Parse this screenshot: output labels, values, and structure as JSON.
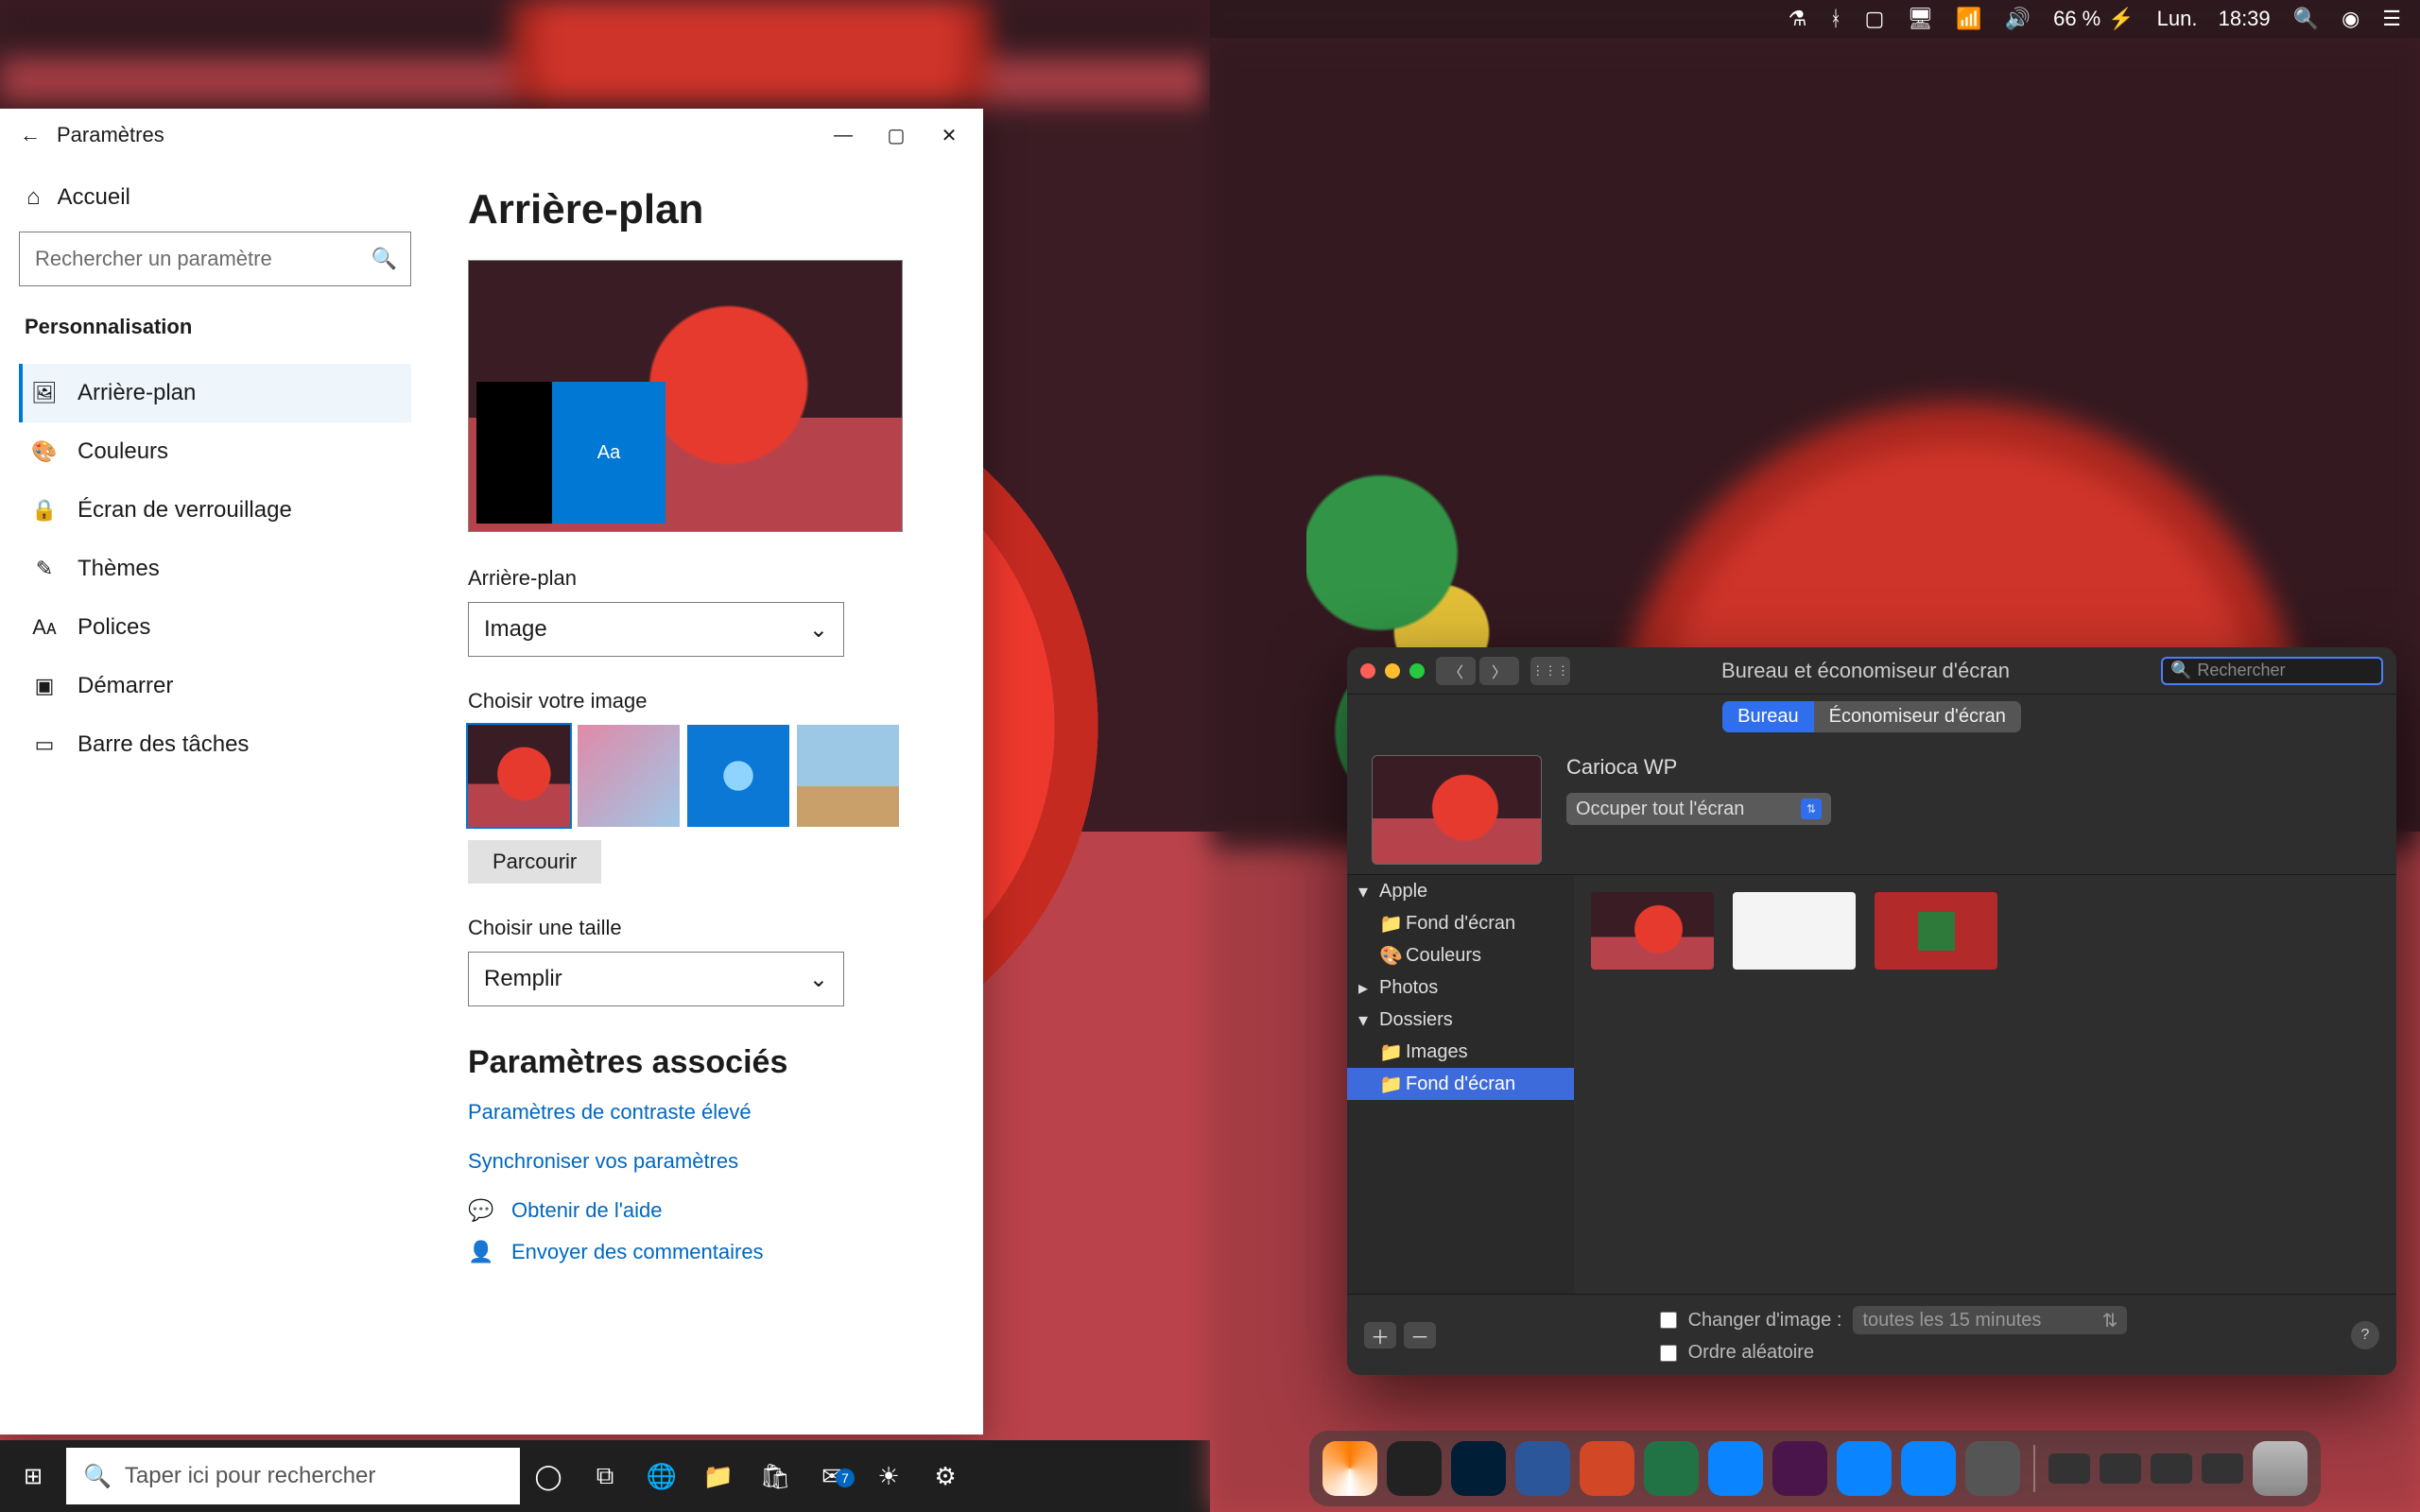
{
  "windows": {
    "titlebar": {
      "title": "Paramètres",
      "back_icon": "←",
      "min": "—",
      "max": "▢",
      "close": "✕"
    },
    "nav": {
      "home_label": "Accueil",
      "search_placeholder": "Rechercher un paramètre",
      "section": "Personnalisation",
      "items": [
        {
          "icon": "🖼",
          "label": "Arrière-plan",
          "active": true
        },
        {
          "icon": "🎨",
          "label": "Couleurs"
        },
        {
          "icon": "🔒",
          "label": "Écran de verrouillage"
        },
        {
          "icon": "✎",
          "label": "Thèmes"
        },
        {
          "icon": "Aᴀ",
          "label": "Polices"
        },
        {
          "icon": "▣",
          "label": "Démarrer"
        },
        {
          "icon": "▭",
          "label": "Barre des tâches"
        }
      ]
    },
    "content": {
      "heading": "Arrière-plan",
      "preview_tile_text": "Aa",
      "bg_label": "Arrière-plan",
      "bg_value": "Image",
      "choose_img_label": "Choisir votre image",
      "browse": "Parcourir",
      "fit_label": "Choisir une taille",
      "fit_value": "Remplir",
      "related_heading": "Paramètres associés",
      "link_contrast": "Paramètres de contraste élevé",
      "link_sync": "Synchroniser vos paramètres",
      "help": "Obtenir de l'aide",
      "feedback": "Envoyer des commentaires"
    },
    "taskbar": {
      "search_placeholder": "Taper ici pour rechercher",
      "icons": [
        "start",
        "search",
        "cortana",
        "taskview",
        "edge",
        "explorer",
        "store",
        "mail",
        "weather",
        "settings"
      ],
      "mail_badge": "7"
    }
  },
  "mac": {
    "menubar": {
      "battery": "66 %",
      "charging": "⚡",
      "day": "Lun.",
      "time": "18:39"
    },
    "window": {
      "title": "Bureau et économiseur d'écran",
      "search_placeholder": "Rechercher",
      "tab_on": "Bureau",
      "tab_off": "Économiseur d'écran",
      "wp_name": "Carioca WP",
      "fit_value": "Occuper tout l'écran",
      "side": {
        "apple": "Apple",
        "apple_wall": "Fond d'écran",
        "apple_colors": "Couleurs",
        "photos": "Photos",
        "folders": "Dossiers",
        "folders_images": "Images",
        "folders_wall": "Fond d'écran"
      },
      "footer": {
        "change_label": "Changer d'image :",
        "interval": "toutes les 15 minutes",
        "random_label": "Ordre aléatoire"
      }
    },
    "dock": [
      "vlc",
      "fcp",
      "ps",
      "word",
      "ppt",
      "xls",
      "store",
      "slack",
      "td",
      "td",
      "pref"
    ]
  }
}
